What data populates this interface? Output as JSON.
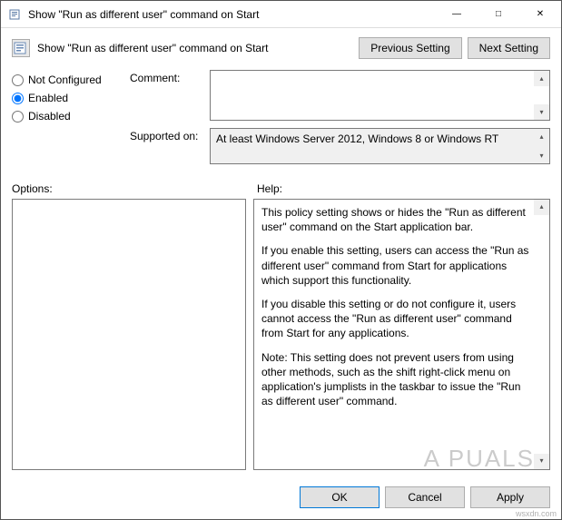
{
  "window": {
    "title": "Show \"Run as different user\" command on Start"
  },
  "header": {
    "title": "Show \"Run as different user\" command on Start",
    "prev": "Previous Setting",
    "next": "Next Setting"
  },
  "radios": {
    "not_configured": "Not Configured",
    "enabled": "Enabled",
    "disabled": "Disabled",
    "selected": "enabled"
  },
  "labels": {
    "comment": "Comment:",
    "supported_on": "Supported on:",
    "options": "Options:",
    "help": "Help:"
  },
  "fields": {
    "comment_value": "",
    "supported_on_value": "At least Windows Server 2012, Windows 8 or Windows RT"
  },
  "help": {
    "p1": "This policy setting shows or hides the \"Run as different user\" command on the Start application bar.",
    "p2": "If you enable this setting, users can access the \"Run as different user\" command from Start for applications which support this functionality.",
    "p3": "If you disable this setting or do not configure it, users cannot access the \"Run as different user\" command from Start for any applications.",
    "p4": "Note: This setting does not prevent users from using other methods, such as the shift right-click menu on application's jumplists in the taskbar to issue the \"Run as different user\" command."
  },
  "buttons": {
    "ok": "OK",
    "cancel": "Cancel",
    "apply": "Apply"
  },
  "watermark": "A   PUALS",
  "source": "wsxdn.com"
}
